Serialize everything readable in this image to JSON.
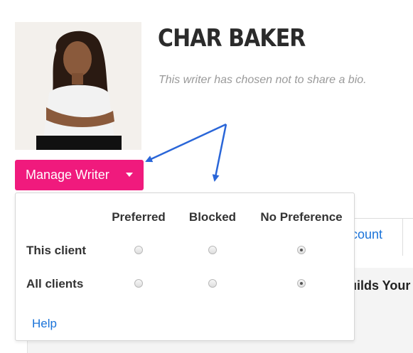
{
  "profile": {
    "name": "CHAR BAKER",
    "bio": "This writer has chosen not to share a bio."
  },
  "manage_button": {
    "label": "Manage Writer"
  },
  "preference_menu": {
    "columns": [
      "Preferred",
      "Blocked",
      "No Preference"
    ],
    "rows": [
      {
        "label": "This client",
        "selected": "No Preference"
      },
      {
        "label": "All clients",
        "selected": "No Preference"
      }
    ],
    "help_label": "Help"
  },
  "background": {
    "tab_label": "count",
    "section_text": "uilds Your"
  },
  "colors": {
    "accent": "#f01a7d",
    "link": "#1a73d9",
    "annotation_arrow": "#2a66d8"
  }
}
